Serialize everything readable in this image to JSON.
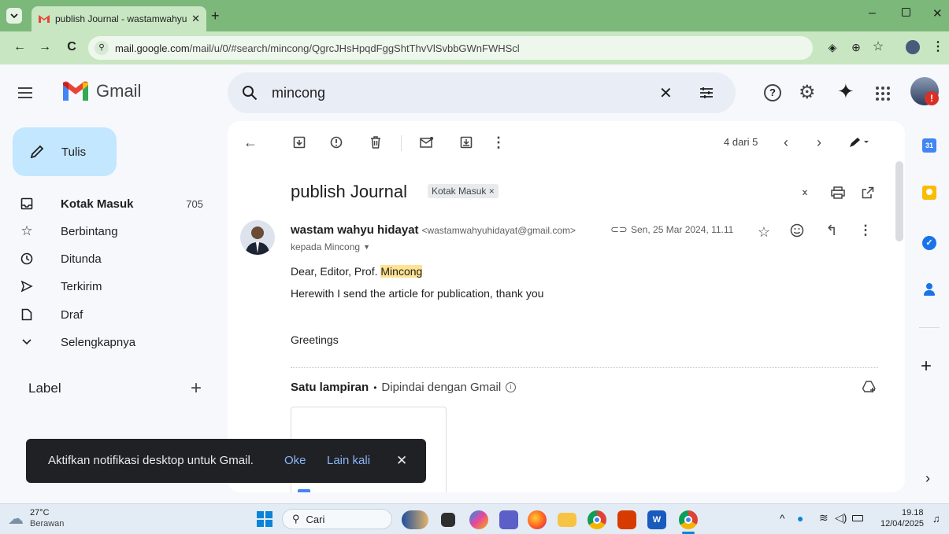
{
  "browser": {
    "tab_title": "publish Journal - wastamwahyu",
    "url_host": "mail.google.com",
    "url_path": "/mail/u/0/#search/mincong/QgrcJHsHpqdFggShtThvVlSvbbGWnFWHScl"
  },
  "gmail": {
    "logo_text": "Gmail",
    "search_value": "mincong",
    "compose_label": "Tulis"
  },
  "sidebar": {
    "items": [
      {
        "label": "Kotak Masuk",
        "count": "705",
        "icon": "inbox-icon"
      },
      {
        "label": "Berbintang",
        "count": "",
        "icon": "star-icon"
      },
      {
        "label": "Ditunda",
        "count": "",
        "icon": "clock-icon"
      },
      {
        "label": "Terkirim",
        "count": "",
        "icon": "send-icon"
      },
      {
        "label": "Draf",
        "count": "",
        "icon": "draft-icon"
      },
      {
        "label": "Selengkapnya",
        "count": "",
        "icon": "chevron-down-icon"
      }
    ],
    "labels_heading": "Label"
  },
  "toolbar": {
    "pager": "4 dari 5"
  },
  "message": {
    "subject": "publish Journal",
    "label_chip": "Kotak Masuk",
    "sender_name": "wastam wahyu hidayat",
    "sender_email": "<wastamwahyuhidayat@gmail.com>",
    "date": "Sen, 25 Mar 2024, 11.11",
    "to_line": "kepada Mincong",
    "body_prefix": "Dear, Editor, Prof. ",
    "body_highlight": "Mincong",
    "body_line2": "Herewith I send the article for publication, thank you",
    "body_line3": "Greetings",
    "attach_title": "Satu lampiran",
    "attach_sep": "•",
    "attach_scan": "Dipindai dengan Gmail"
  },
  "snackbar": {
    "text": "Aktifkan notifikasi desktop untuk Gmail.",
    "ok": "Oke",
    "later": "Lain kali"
  },
  "taskbar": {
    "temp": "27°C",
    "weather": "Berawan",
    "search": "Cari",
    "time": "19.18",
    "date": "12/04/2025"
  },
  "colors": {
    "highlight": "#fde293",
    "compose": "#c2e7ff",
    "accent_blue": "#8ab4f8"
  }
}
